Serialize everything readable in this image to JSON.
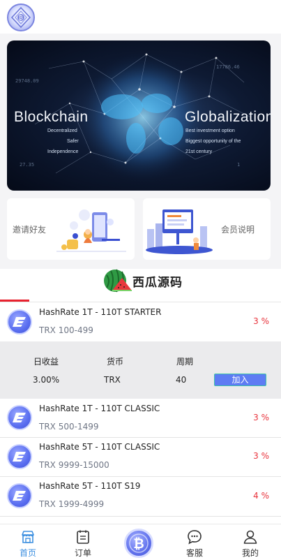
{
  "banner": {
    "title_left": "Blockchain",
    "title_right": "Globalization",
    "left_lines": [
      "Decentralized",
      "Safer",
      "Independence"
    ],
    "right_lines": [
      "Best investment option",
      "Biggest opportunity of the",
      "21st century"
    ]
  },
  "cards": {
    "invite_label": "邀请好友",
    "member_label": "会员说明"
  },
  "brand": {
    "text": "西瓜源码"
  },
  "products": [
    {
      "name": "HashRate 1T - 110T STARTER",
      "range": "TRX 100-499",
      "rate": "3 %"
    },
    {
      "name": "HashRate 1T - 110T CLASSIC",
      "range": "TRX 500-1499",
      "rate": "3 %"
    },
    {
      "name": "HashRate 5T - 110T CLASSIC",
      "range": "TRX 9999-15000",
      "rate": "3 %"
    },
    {
      "name": "HashRate 5T - 110T S19",
      "range": "TRX 1999-4999",
      "rate": "4 %"
    }
  ],
  "detail": {
    "col1_header": "日收益",
    "col2_header": "货币",
    "col3_header": "周期",
    "col1_value": "3.00%",
    "col2_value": "TRX",
    "col3_value": "40",
    "join_label": "加入"
  },
  "tabs": {
    "home": "首页",
    "orders": "订单",
    "service": "客服",
    "mine": "我的"
  },
  "colors": {
    "accent_blue": "#5e7cf3",
    "rate_red": "#e8333c",
    "active_tab": "#3c8fe0"
  }
}
